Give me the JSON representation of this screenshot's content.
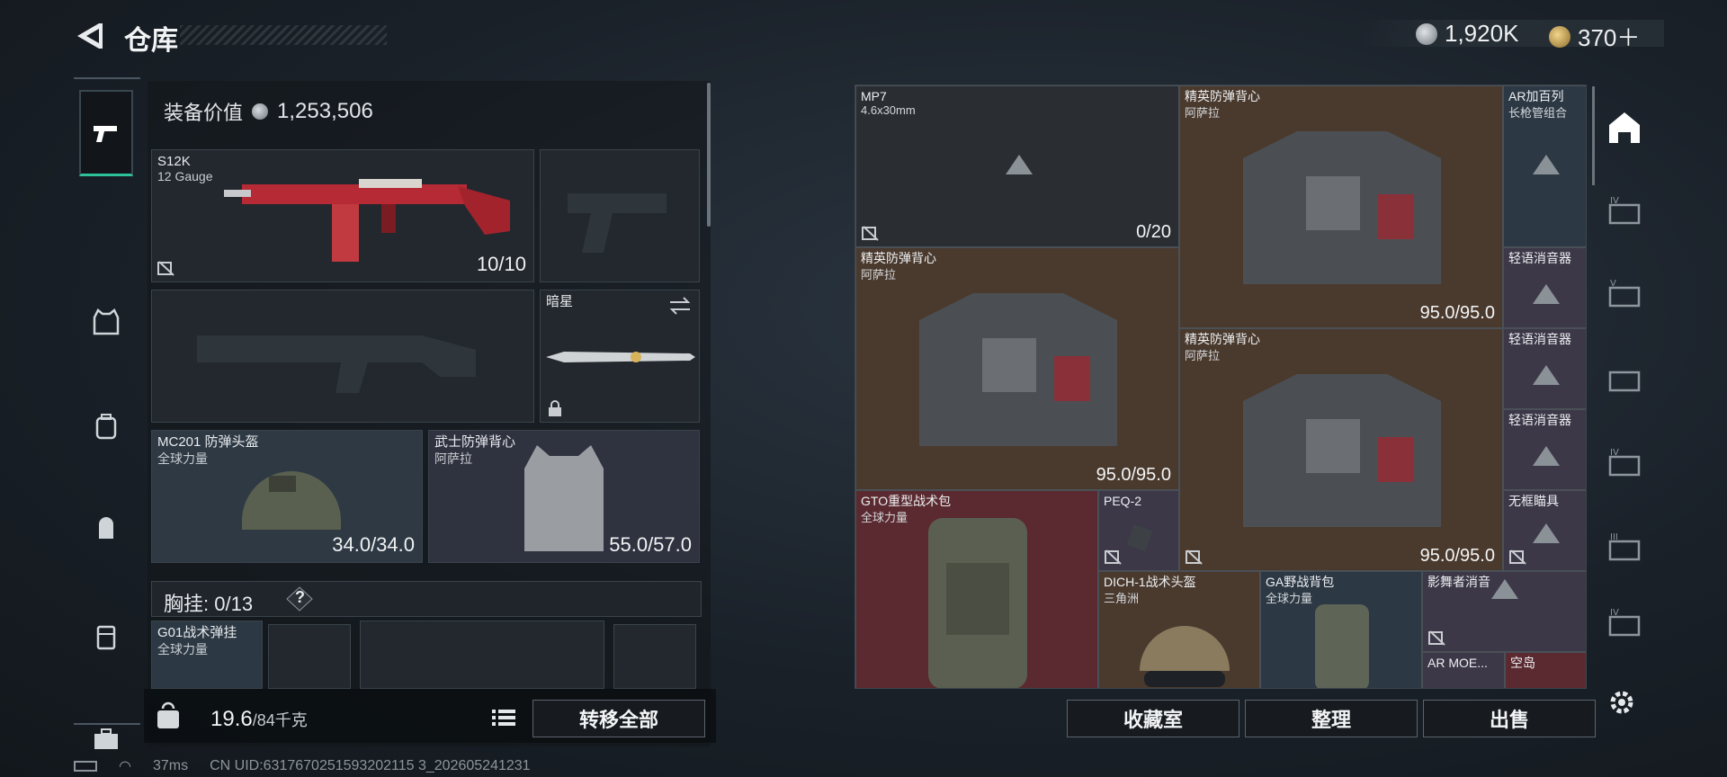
{
  "header": {
    "title": "仓库",
    "currency": [
      {
        "icon": "silver-coin-icon",
        "value": "1,920K"
      },
      {
        "icon": "gold-coin-icon",
        "value": "370＋"
      }
    ]
  },
  "equipment": {
    "value_label": "装备价值",
    "value": "1,253,506",
    "primary_weapon": {
      "name": "S12K",
      "sub": "12 Gauge",
      "stat": "10/10"
    },
    "melee": {
      "name": "暗星"
    },
    "helmet": {
      "name": "MC201 防弹头盔",
      "sub": "全球力量",
      "stat": "34.0/34.0"
    },
    "armor": {
      "name": "武士防弹背心",
      "sub": "阿萨拉",
      "stat": "55.0/57.0"
    },
    "chest_rig": {
      "label": "胸挂:",
      "count": "0/13",
      "help": "?"
    },
    "rig_item": {
      "name": "G01战术弹挂",
      "sub": "全球力量"
    }
  },
  "bottom": {
    "weight": "19.6",
    "weight_cap": "/84千克",
    "transfer_all": "转移全部",
    "collection": "收藏室",
    "organize": "整理",
    "sell": "出售"
  },
  "stash_items": [
    {
      "name": "MP7",
      "sub": "4.6x30mm",
      "stat": "0/20"
    },
    {
      "name": "精英防弹背心",
      "sub": "阿萨拉",
      "stat": ""
    },
    {
      "name": "AR加百列",
      "sub": "长枪管组合",
      "stat": ""
    },
    {
      "name": "精英防弹背心",
      "sub": "阿萨拉",
      "stat": "95.0/95.0"
    },
    {
      "name": "轻语消音器",
      "sub": "",
      "stat": ""
    },
    {
      "name": "精英防弹背心",
      "sub": "阿萨拉",
      "stat": "95.0/95.0"
    },
    {
      "name": "轻语消音器",
      "sub": "",
      "stat": ""
    },
    {
      "name": "轻语消音器",
      "sub": "",
      "stat": ""
    },
    {
      "name": "GTO重型战术包",
      "sub": "全球力量",
      "stat": ""
    },
    {
      "name": "PEQ-2",
      "sub": "",
      "stat": ""
    },
    {
      "name": "无框瞄具",
      "sub": "",
      "stat": ""
    },
    {
      "name": "DICH-1战术头盔",
      "sub": "三角洲",
      "stat": ""
    },
    {
      "name": "GA野战背包",
      "sub": "全球力量",
      "stat": ""
    },
    {
      "name": "影舞者消音",
      "sub": "",
      "stat": ""
    },
    {
      "name": "AR MOE...",
      "sub": "",
      "stat": ""
    },
    {
      "name": "空岛",
      "sub": "",
      "stat": ""
    }
  ],
  "stash_top_stat": "95.0/95.0",
  "status": {
    "ping": "37ms",
    "uid": "CN UID:6317670251593202115 3_202605241231"
  }
}
